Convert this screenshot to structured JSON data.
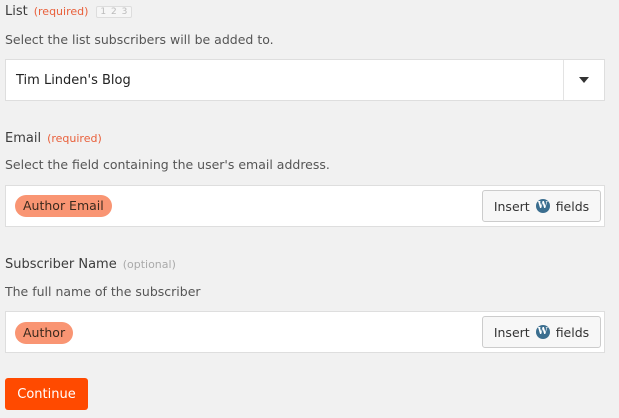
{
  "colors": {
    "accent": "#ff4a00",
    "required_text": "#e9603b",
    "pill_bg": "#f99573"
  },
  "list": {
    "label": "List",
    "required": "(required)",
    "badge": "1 2 3",
    "description": "Select the list subscribers will be added to.",
    "selected_value": "Tim Linden's Blog",
    "dropdown_icon": "caret-down-icon"
  },
  "email": {
    "label": "Email",
    "required": "(required)",
    "description": "Select the field containing the user's email address.",
    "pill": "Author Email",
    "insert": {
      "before": "Insert",
      "after": "fields",
      "icon": "wordpress-icon"
    }
  },
  "subscriber_name": {
    "label": "Subscriber Name",
    "optional": "(optional)",
    "description": "The full name of the subscriber",
    "pill": "Author",
    "insert": {
      "before": "Insert",
      "after": "fields",
      "icon": "wordpress-icon"
    }
  },
  "continue_label": "Continue"
}
